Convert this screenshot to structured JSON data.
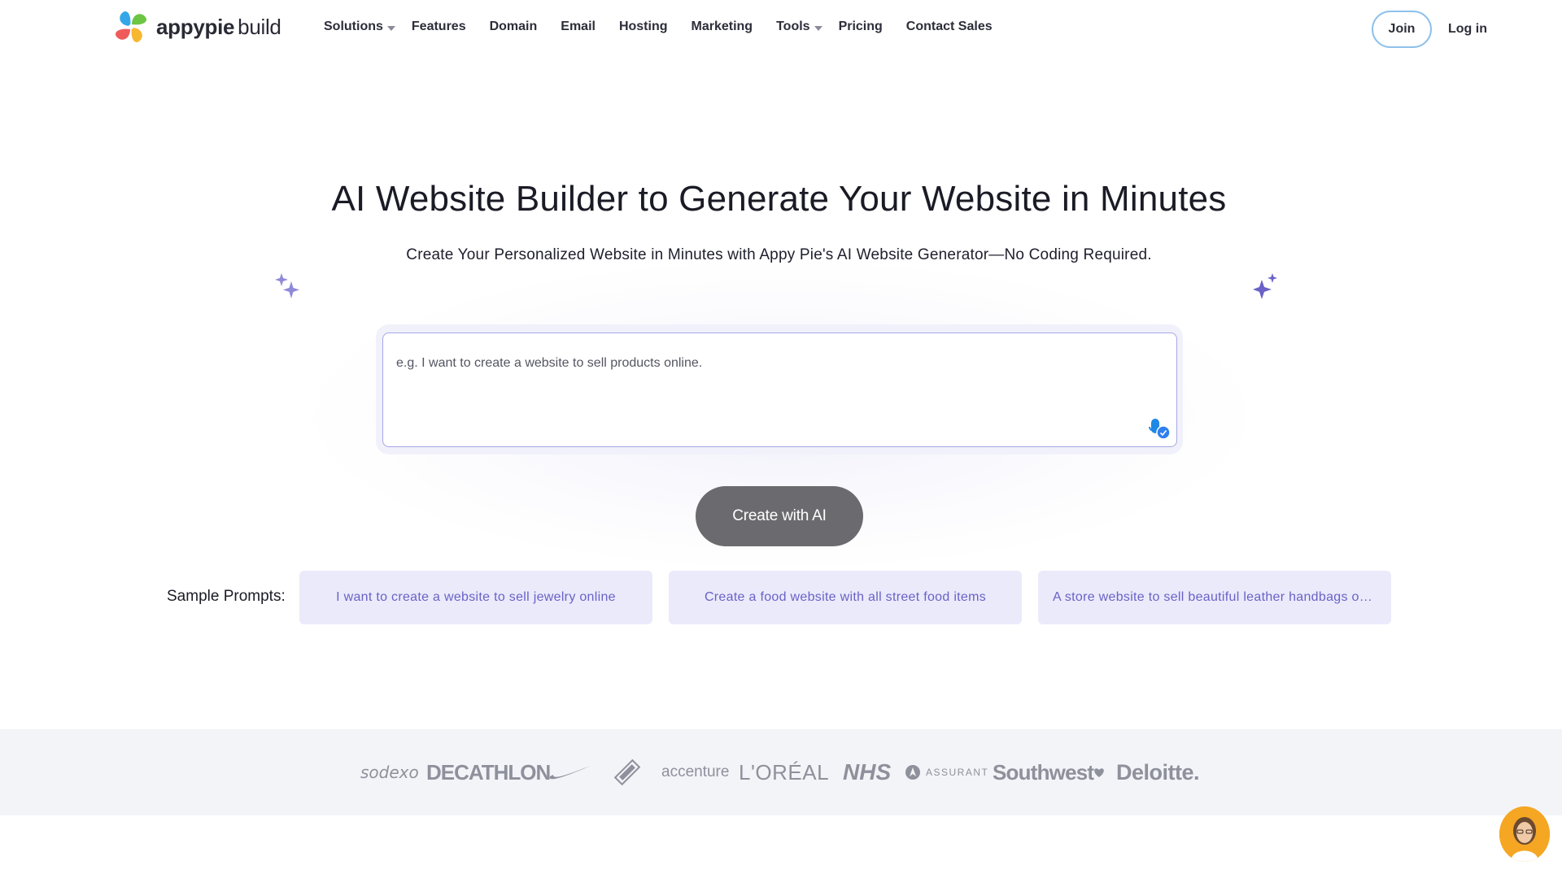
{
  "header": {
    "logo": {
      "brand_bold": "appypie",
      "brand_light": "build"
    },
    "nav": [
      {
        "label": "Solutions",
        "has_dropdown": true
      },
      {
        "label": "Features",
        "has_dropdown": false
      },
      {
        "label": "Domain",
        "has_dropdown": false
      },
      {
        "label": "Email",
        "has_dropdown": false
      },
      {
        "label": "Hosting",
        "has_dropdown": false
      },
      {
        "label": "Marketing",
        "has_dropdown": false
      },
      {
        "label": "Tools",
        "has_dropdown": true
      },
      {
        "label": "Pricing",
        "has_dropdown": false
      },
      {
        "label": "Contact Sales",
        "has_dropdown": false
      }
    ],
    "join_label": "Join",
    "login_label": "Log in"
  },
  "hero": {
    "title": "AI Website Builder to Generate Your Website in Minutes",
    "subtitle": "Create Your Personalized Website in Minutes with Appy Pie's AI Website Generator—No Coding Required.",
    "prompt_placeholder": "e.g. I want to create a website to sell products online.",
    "create_button": "Create with AI",
    "sample_label": "Sample Prompts:",
    "samples": [
      "I want to create a website to sell jewelry online",
      "Create a food website with all street food items",
      "A store website to sell beautiful leather handbags onl..."
    ]
  },
  "brands": {
    "sodexo": "sodexo",
    "decathlon": "DECATHLON",
    "accenture": "accenture",
    "loreal": "L'ORÉAL",
    "nhs": "NHS",
    "assurant": "ASSURANT",
    "southwest": "Southwest",
    "deloitte": "Deloitte."
  },
  "colors": {
    "accent": "#6a62c7",
    "chip_bg": "#eaeafb",
    "button_bg": "#6b6b6f",
    "join_border": "#8ec1ec",
    "band_bg": "#f3f4f8"
  }
}
